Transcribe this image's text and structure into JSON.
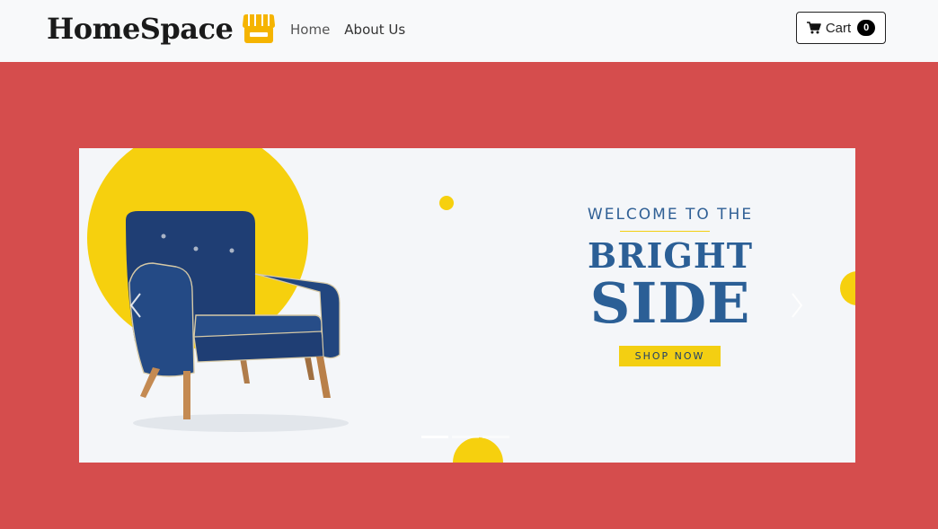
{
  "navbar": {
    "brand": "HomeSpace",
    "brand_icon": "store-icon",
    "links": [
      {
        "label": "Home"
      },
      {
        "label": "About Us"
      }
    ],
    "cart": {
      "label": "Cart",
      "count": "0",
      "icon": "cart-icon"
    }
  },
  "hero": {
    "welcome": "WELCOME TO THE",
    "headline_1": "BRIGHT",
    "headline_2": "SIDE",
    "cta": "SHOP NOW",
    "prev_icon": "chevron-left-icon",
    "next_icon": "chevron-right-icon",
    "slide_count": 3,
    "active_slide": 1
  },
  "colors": {
    "hero_background": "#d54d4d",
    "accent_yellow": "#f3cf12",
    "headline_blue": "#2b5f96",
    "navbar_background": "#f8f9fa"
  }
}
